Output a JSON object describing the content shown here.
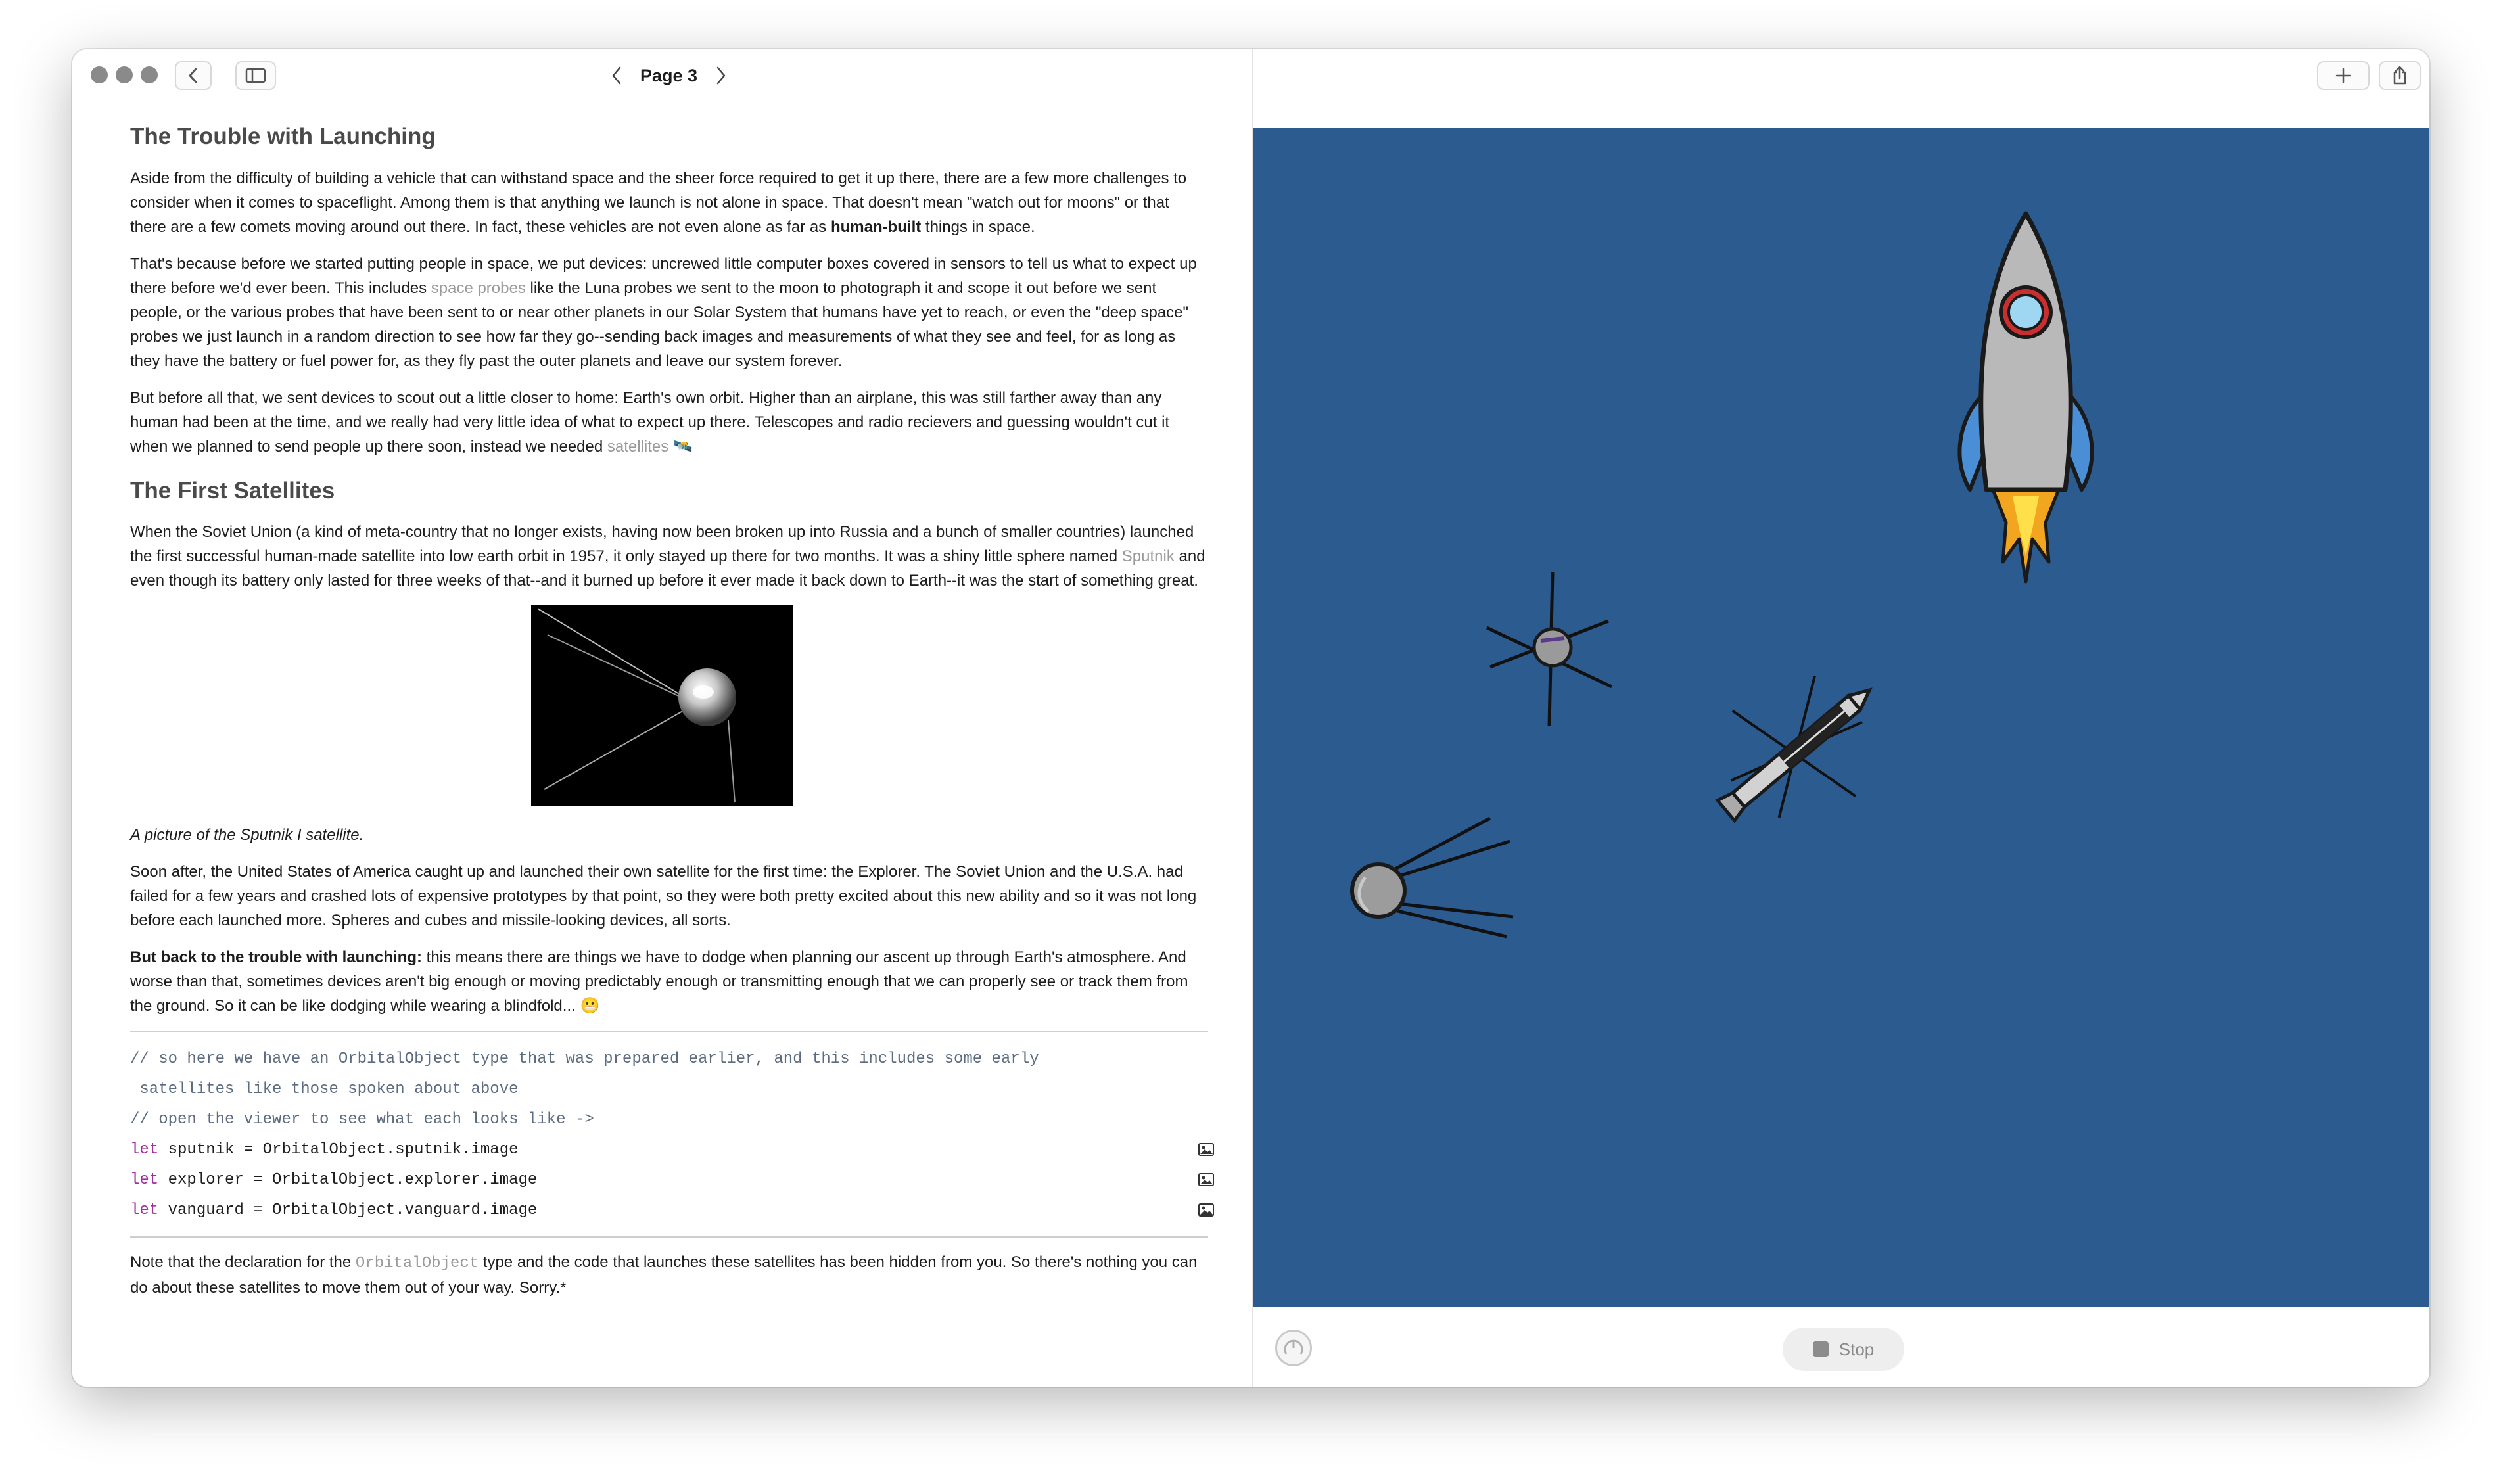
{
  "toolbar": {
    "page_title": "Page 3",
    "icons": [
      "chevron-left-icon",
      "sidebar-icon",
      "chevron-left-icon",
      "chevron-right-icon",
      "plus-icon",
      "share-icon"
    ]
  },
  "doc": {
    "h1": "The Trouble with Launching",
    "p1": {
      "a": "Aside from the difficulty of building a vehicle that can withstand space and the sheer force required to get it up there, there are a few more challenges to consider when it comes to spaceflight. Among them is that anything we launch is not alone in space. That doesn't mean \"watch out for moons\" or that there are a few comets moving around out there. In fact, these vehicles are not even alone as far as ",
      "bold": "human-built",
      "b": " things in space."
    },
    "p2": {
      "a": "That's because before we started putting people in space, we put devices: uncrewed little computer boxes covered in sensors to tell us what to expect up there before we'd ever been. This includes ",
      "link": "space probes",
      "b": " like the Luna probes we sent to the moon to photograph it and scope it out before we sent people, or the various probes that have been sent to or near other planets in our Solar System that humans have yet to reach, or even the \"deep space\" probes we just launch in a random direction to see how far they go--sending back images and measurements of what they see and feel, for as long as they have the battery or fuel power for, as they fly past the outer planets and leave our system forever."
    },
    "p3": {
      "a": "But before all that, we sent devices to scout out a little closer to home: Earth's own orbit. Higher than an airplane, this was still farther away than any human had been at the time, and we really had very little idea of what to expect up there. Telescopes and radio recievers and guessing wouldn't cut it when we planned to send people up there soon, instead we needed ",
      "link": "satellites",
      "emoji": "🛰️"
    },
    "h2": "The First Satellites",
    "p4": {
      "a": "When the Soviet Union (a kind of meta-country that no longer exists, having now been broken up into Russia and a bunch of smaller countries) launched the first successful human-made satellite into low earth orbit in 1957, it only stayed up there for two months. It was a shiny little sphere named ",
      "link": "Sputnik",
      "b": " and even though its battery only lasted for three weeks of that--and it burned up before it ever made it back down to Earth--it was the start of something great."
    },
    "caption": "A picture of the Sputnik I satellite.",
    "p5": "Soon after, the United States of America caught up and launched their own satellite for the first time: the Explorer. The Soviet Union and the U.S.A. had failed for a few years and crashed lots of expensive prototypes by that point, so they were both pretty excited about this new ability and so it was not long before each launched more. Spheres and cubes and missile-looking devices, all sorts.",
    "p6": {
      "bold": "But back to the trouble with launching:",
      "a": " this means there are things we have to dodge when planning our ascent up through Earth's atmosphere. And worse than that, sometimes devices aren't big enough or moving predictably enough or transmitting enough that we can properly see or track them from the ground. So it can be like dodging while wearing a blindfold... ",
      "emoji": "😬"
    },
    "code": {
      "comment1": "// so here we have an OrbitalObject type that was prepared earlier, and this includes some early",
      "comment1b": " satellites like those spoken about above",
      "comment2": "// open the viewer to see what each looks like ->",
      "kw": "let",
      "line1": " sputnik = OrbitalObject.sputnik.image",
      "line2": " explorer = OrbitalObject.explorer.image",
      "line3": " vanguard = OrbitalObject.vanguard.image"
    },
    "p7": {
      "a": "Note that the declaration for the ",
      "code": "OrbitalObject",
      "b": " type and the code that launches these satellites has been hidden from you. So there's nothing you can do about these satellites to move them out of your way. Sorry.*"
    }
  },
  "viewer": {
    "canvas_color": "#2c5b8f",
    "stop_label": "Stop",
    "objects": [
      "rocket",
      "sputnik",
      "explorer",
      "vanguard"
    ]
  }
}
